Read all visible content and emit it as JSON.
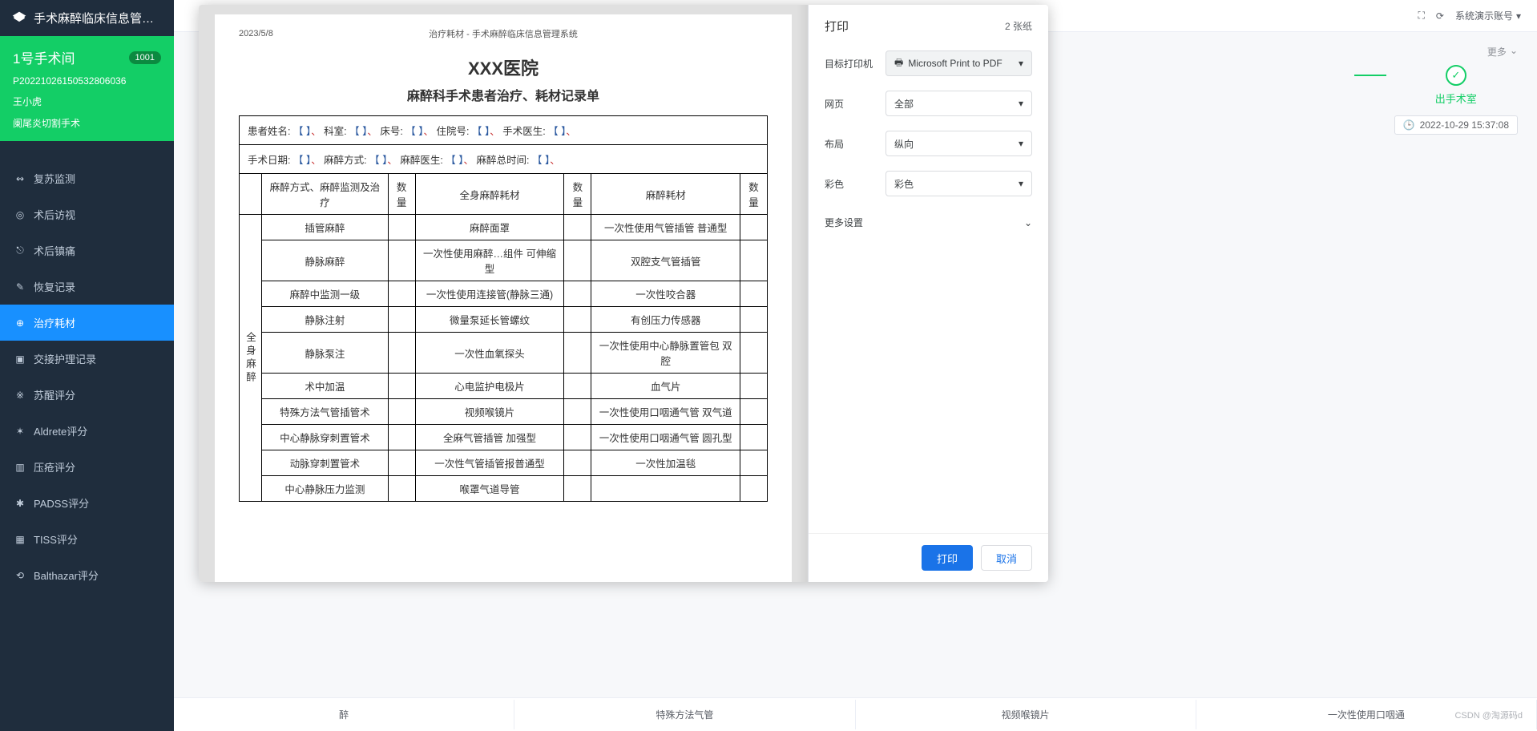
{
  "app_title": "手术麻醉临床信息管…",
  "topbar": {
    "account": "系统演示账号",
    "fullscreen": "全屏"
  },
  "room": {
    "title": "1号手术间",
    "badge": "1001",
    "patient_id": "P20221026150532806036",
    "patient_name": "王小虎",
    "surgery": "阑尾炎切割手术"
  },
  "nav": [
    {
      "icon": "↭",
      "label": "复苏监测"
    },
    {
      "icon": "◎",
      "label": "术后访视"
    },
    {
      "icon": "⎋",
      "label": "术后镇痛"
    },
    {
      "icon": "✎",
      "label": "恢复记录"
    },
    {
      "icon": "⊕",
      "label": "治疗耗材",
      "active": true
    },
    {
      "icon": "▣",
      "label": "交接护理记录"
    },
    {
      "icon": "※",
      "label": "苏醒评分"
    },
    {
      "icon": "✶",
      "label": "Aldrete评分"
    },
    {
      "icon": "▥",
      "label": "压疮评分"
    },
    {
      "icon": "✱",
      "label": "PADSS评分"
    },
    {
      "icon": "▦",
      "label": "TISS评分"
    },
    {
      "icon": "⟲",
      "label": "Balthazar评分"
    }
  ],
  "steps": {
    "label": "出手术室",
    "time": "2022-10-29 15:37:08",
    "more": "更多"
  },
  "bg_strip": [
    "醉",
    "特殊方法气管",
    "视频喉镜片",
    "一次性使用口咽通"
  ],
  "print": {
    "title": "打印",
    "pages": "2 张纸",
    "dest_label": "目标打印机",
    "dest_value": "Microsoft Print to PDF",
    "pages_label": "网页",
    "pages_value": "全部",
    "layout_label": "布局",
    "layout_value": "纵向",
    "color_label": "彩色",
    "color_value": "彩色",
    "more_settings": "更多设置",
    "btn_print": "打印",
    "btn_cancel": "取消"
  },
  "paper": {
    "date": "2023/5/8",
    "header": "治疗耗材 - 手术麻醉临床信息管理系统",
    "hospital": "XXX医院",
    "title": "麻醉科手术患者治疗、耗材记录单",
    "info1_labels": [
      "患者姓名:",
      "科室:",
      "床号:",
      "住院号:",
      "手术医生:"
    ],
    "info2_labels": [
      "手术日期:",
      "麻醉方式:",
      "麻醉医生:",
      "麻醉总时间:"
    ],
    "bracket": "【 】",
    "dot": "、",
    "col_headers": [
      "麻醉方式、麻醉监测及治疗",
      "数量",
      "全身麻醉耗材",
      "数量",
      "麻醉耗材",
      "数量"
    ],
    "vheader": "全身麻醉",
    "rows": [
      {
        "c1": "插管麻醉",
        "c3": "麻醉面罩",
        "c5": "一次性使用气管插管 普通型"
      },
      {
        "c1": "静脉麻醉",
        "c3": "一次性使用麻醉…组件 可伸缩型",
        "c5": "双腔支气管插管"
      },
      {
        "c1": "麻醉中监测一级",
        "c3": "一次性使用连接管(静脉三通)",
        "c5": "一次性咬合器"
      },
      {
        "c1": "静脉注射",
        "c3": "微量泵延长管螺纹",
        "c5": "有创压力传感器"
      },
      {
        "c1": "静脉泵注",
        "c3": "一次性血氧探头",
        "c5": "一次性使用中心静脉置管包 双腔"
      },
      {
        "c1": "术中加温",
        "c3": "心电监护电极片",
        "c5": "血气片"
      },
      {
        "c1": "特殊方法气管插管术",
        "c3": "视频喉镜片",
        "c5": "一次性使用口咽通气管 双气道"
      },
      {
        "c1": "中心静脉穿刺置管术",
        "c3": "全麻气管插管 加强型",
        "c5": "一次性使用口咽通气管 圆孔型"
      },
      {
        "c1": "动脉穿刺置管术",
        "c3": "一次性气管插管报普通型",
        "c5": "一次性加温毯"
      },
      {
        "c1": "中心静脉压力监测",
        "c3": "喉罩气道导管",
        "c5": ""
      }
    ]
  },
  "watermark": "CSDN @淘源码d"
}
